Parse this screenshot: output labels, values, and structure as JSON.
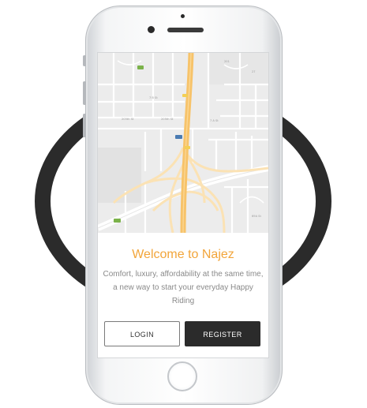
{
  "app": {
    "welcome": "Welcome to Najez",
    "tagline": "Comfort, luxury, affordability at the same time, a new way to start your everyday Happy Riding",
    "login_label": "LOGIN",
    "register_label": "REGISTER"
  },
  "colors": {
    "accent": "#f2a53a",
    "ring": "#2b2b2b",
    "register_bg": "#2b2b2b"
  }
}
